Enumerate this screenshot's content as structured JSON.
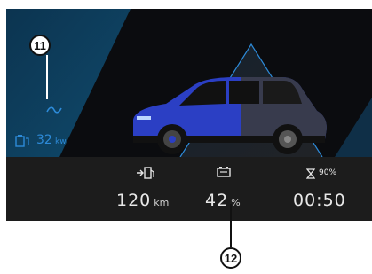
{
  "callouts": {
    "top_left": "11",
    "bottom": "12"
  },
  "power": {
    "icon": "battery-charge-icon",
    "value": "32",
    "unit": "kw"
  },
  "stats": {
    "range": {
      "icon": "fuel-pump-range-icon",
      "value": "120",
      "unit": "km"
    },
    "battery": {
      "icon": "battery-icon",
      "value": "42",
      "unit": "%"
    },
    "time": {
      "icon": "hourglass-icon",
      "percent": "90%",
      "value": "00:50"
    }
  },
  "colors": {
    "accent_blue": "#2d8ad8",
    "teal_panel": "#0f3f5c",
    "car_body": "#2b3fc4",
    "screen_bg": "#0b0c0f",
    "info_bar": "#1a1a1a"
  }
}
